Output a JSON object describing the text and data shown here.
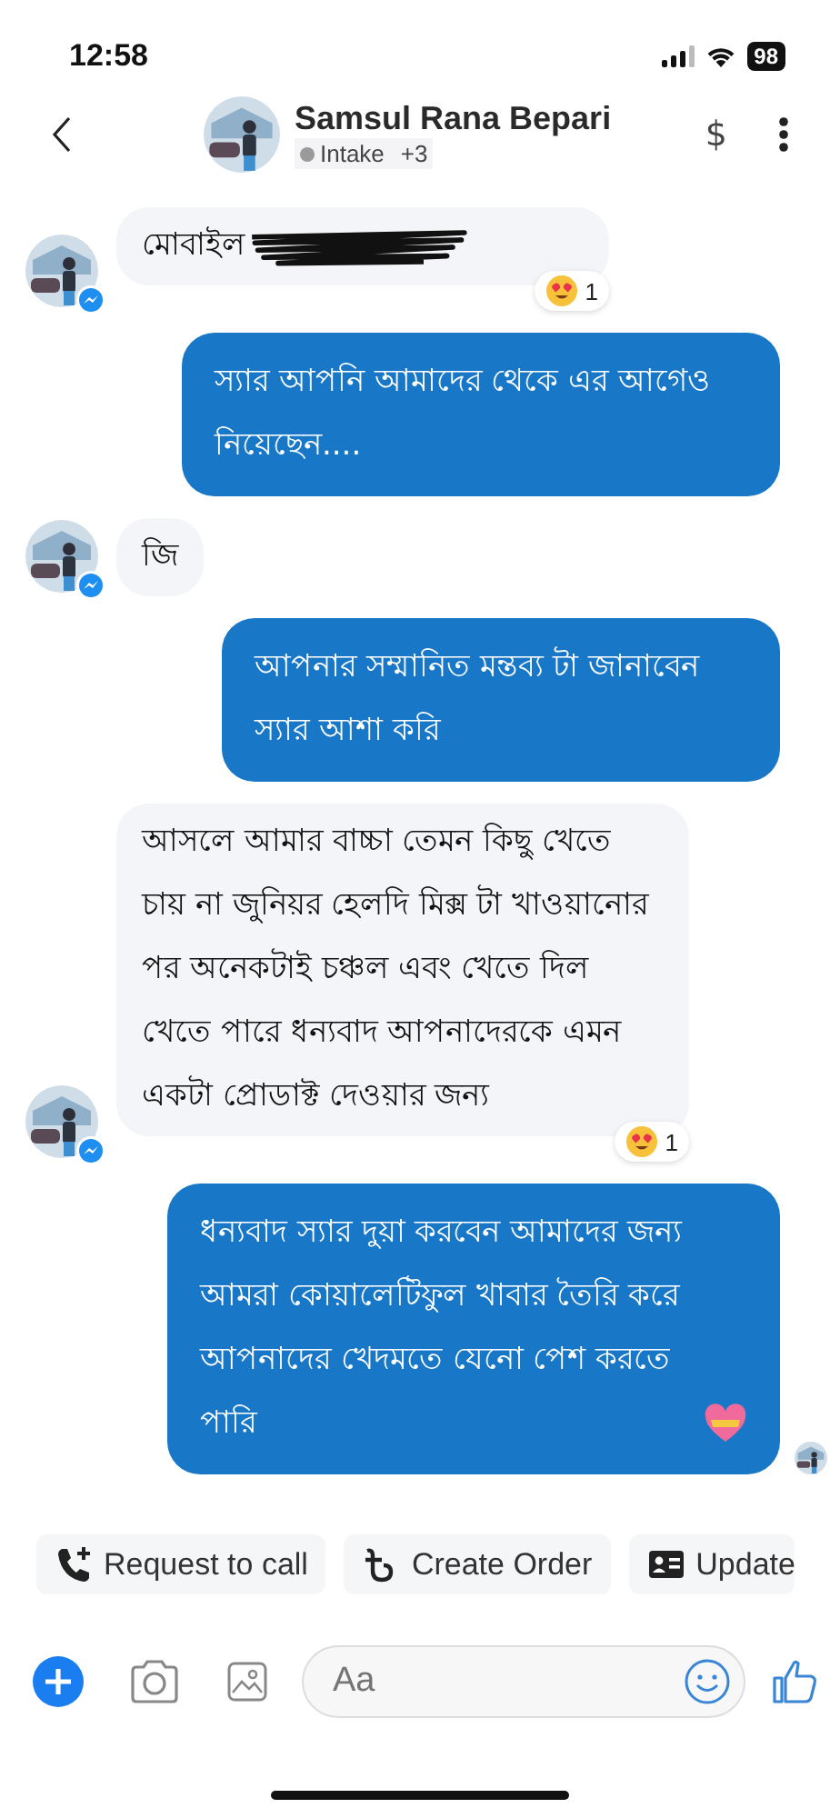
{
  "status_bar": {
    "time": "12:58",
    "battery": "98"
  },
  "header": {
    "name": "Samsul Rana Bepari",
    "label": "Intake",
    "label_extra": "+3",
    "currency": "$"
  },
  "messages": [
    {
      "kind": "incoming",
      "text": "মোবাইল",
      "redacted": true,
      "avatar": true,
      "reaction": {
        "count": "1"
      }
    },
    {
      "kind": "outgoing",
      "text": "স্যার আপনি আমাদের থেকে এর আগেও নিয়েছেন...."
    },
    {
      "kind": "incoming",
      "text": "জি",
      "avatar": true
    },
    {
      "kind": "outgoing",
      "text": "আপনার সম্মানিত মন্তব্য টা জানাবেন স্যার আশা করি"
    },
    {
      "kind": "incoming",
      "text": "আসলে আমার বাচ্চা তেমন কিছু খেতে চায় না জুনিয়র হেলদি মিক্স টা খাওয়ানোর পর অনেকটাই চঞ্চল এবং খেতে দিল খেতে পারে  ধন্যবাদ আপনাদেরকে এমন একটা প্রোডাক্ট দেওয়ার  জন্য",
      "avatar": true,
      "reaction": {
        "count": "1"
      }
    },
    {
      "kind": "outgoing",
      "text": "ধন্যবাদ স্যার  দুয়া করবেন আমাদের জন্য আমরা কোয়ালেটিফুল খাবার তৈরি করে আপনাদের খেদমতে  যেনো পেশ করতে পারি",
      "emoji_end": true,
      "seen": true
    }
  ],
  "quick_replies": [
    {
      "kind": "call",
      "label": "Request to call"
    },
    {
      "kind": "taka",
      "label": "Create Order"
    },
    {
      "kind": "card",
      "label": "Update"
    }
  ],
  "composer": {
    "placeholder": "Aa"
  }
}
